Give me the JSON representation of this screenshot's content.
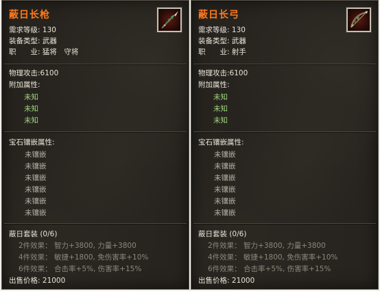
{
  "tooltips": [
    {
      "name": "蔽日长枪",
      "icon": "spear-icon",
      "req_level_label": "需求等级:",
      "req_level": "130",
      "equip_type_label": "装备类型:",
      "equip_type": "武器",
      "job_label": "职　　业:",
      "job": "猛将　守将",
      "attack": "物理攻击:6100",
      "extra_attr_label": "附加属性:",
      "extra_attrs": [
        "未知",
        "未知",
        "未知"
      ],
      "gem_label": "宝石镶嵌属性:",
      "gems": [
        "未镶嵌",
        "未镶嵌",
        "未镶嵌",
        "未镶嵌",
        "未镶嵌",
        "未镶嵌"
      ],
      "set_name": "蔽日套装 (0/6)",
      "set_effects": [
        {
          "label": "2件效果：",
          "text": "智力+3800, 力量+3800"
        },
        {
          "label": "4件效果：",
          "text": "敏捷+1800, 免伤害率+10%"
        },
        {
          "label": "6件效果：",
          "text": "合击率+5%, 伤害率+15%"
        }
      ],
      "price_label": "出售价格:",
      "price": "21000"
    },
    {
      "name": "蔽日长弓",
      "icon": "bow-icon",
      "req_level_label": "需求等级:",
      "req_level": "130",
      "equip_type_label": "装备类型:",
      "equip_type": "武器",
      "job_label": "职　　业:",
      "job": "射手",
      "attack": "物理攻击:6100",
      "extra_attr_label": "附加属性:",
      "extra_attrs": [
        "未知",
        "未知",
        "未知"
      ],
      "gem_label": "宝石镶嵌属性:",
      "gems": [
        "未镶嵌",
        "未镶嵌",
        "未镶嵌",
        "未镶嵌",
        "未镶嵌",
        "未镶嵌"
      ],
      "set_name": "蔽日套装 (0/6)",
      "set_effects": [
        {
          "label": "2件效果：",
          "text": "智力+3800, 力量+3800"
        },
        {
          "label": "4件效果：",
          "text": "敏捷+1800, 免伤害率+10%"
        },
        {
          "label": "6件效果：",
          "text": "合击率+5%, 伤害率+15%"
        }
      ],
      "price_label": "出售价格:",
      "price": "21000"
    }
  ],
  "colors": {
    "title": "#ff7a1c",
    "unknown_attr": "#9cd27f",
    "panel_bg": "#27241f"
  }
}
